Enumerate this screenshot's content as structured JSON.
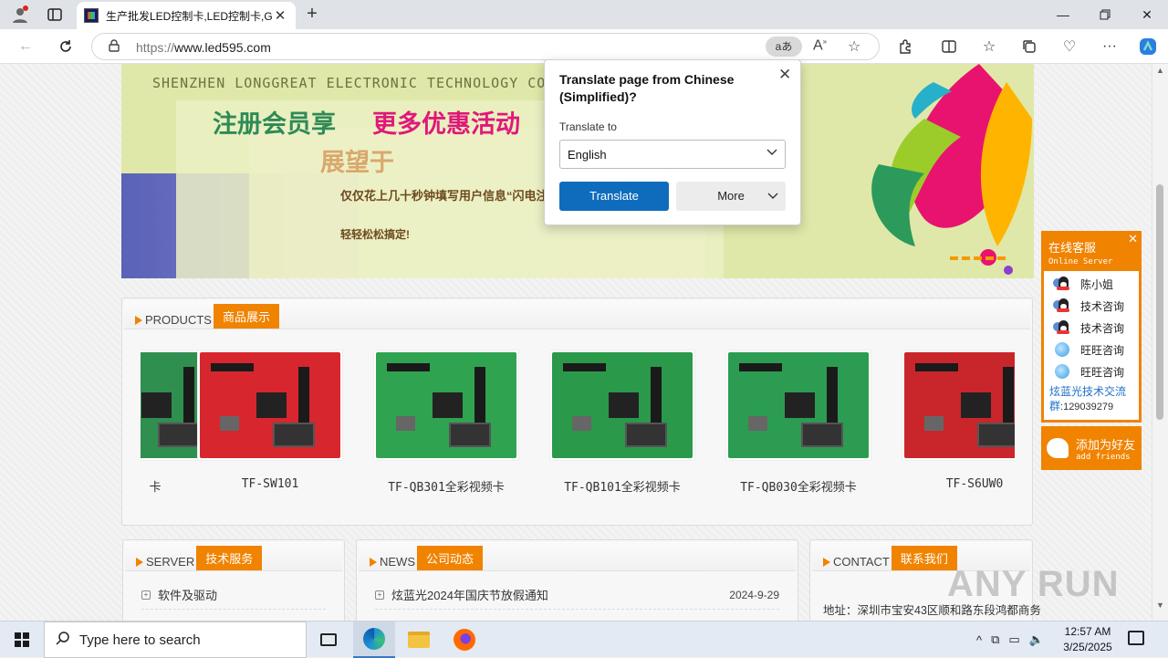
{
  "browser": {
    "tab_title": "生产批发LED控制卡,LED控制卡,G",
    "url_prefix": "https://",
    "url_host": "www.led595.com",
    "translate_icon": "aあ"
  },
  "banner": {
    "english_line": "SHENZHEN LONGGREAT ELECTRONIC TECHNOLOGY CO.,LTD",
    "line1_a": "注册会员享",
    "line1_b": "更多优惠活动",
    "line2": "展望于",
    "line3": "仅仅花上几十秒钟填写用户信息“闪电注册”，",
    "line4": "轻轻松松搞定!"
  },
  "products": {
    "title_en": "PRODUCTS",
    "title_cn": "商品展示",
    "items": [
      {
        "name": "卡",
        "color": "#2f8f4e"
      },
      {
        "name": "TF-SW101",
        "color": "#d8262e"
      },
      {
        "name": "TF-QB301全彩视频卡",
        "color": "#2fa34f"
      },
      {
        "name": "TF-QB101全彩视频卡",
        "color": "#2a9a4a"
      },
      {
        "name": "TF-QB030全彩视频卡",
        "color": "#2b9c52"
      },
      {
        "name": "TF-S6UW0",
        "color": "#c9262c"
      }
    ]
  },
  "server": {
    "title_en": "SERVER",
    "title_cn": "技术服务",
    "items": [
      {
        "text": "软件及驱动"
      }
    ]
  },
  "news": {
    "title_en": "NEWS",
    "title_cn": "公司动态",
    "items": [
      {
        "text": "炫蓝光2024年国庆节放假通知",
        "date": "2024-9-29"
      }
    ]
  },
  "contact": {
    "title_en": "CONTACT",
    "title_cn": "联系我们",
    "address": "地址：深圳市宝安43区顺和路东段鸿都商务"
  },
  "translate_popup": {
    "title": "Translate page from Chinese (Simplified)?",
    "label": "Translate to",
    "selected_language": "English",
    "translate_button": "Translate",
    "more_button": "More"
  },
  "chat": {
    "title_cn": "在线客服",
    "title_en": "Online Server",
    "contacts": [
      {
        "name": "陈小姐",
        "type": "qq"
      },
      {
        "name": "技术咨询",
        "type": "qq"
      },
      {
        "name": "技术咨询",
        "type": "qq"
      },
      {
        "name": "旺旺咨询",
        "type": "wangwang"
      },
      {
        "name": "旺旺咨询",
        "type": "wangwang"
      }
    ],
    "group_label": "炫蓝光技术交流群",
    "group_number": ":129039279",
    "add_cn": "添加为好友",
    "add_en": "add friends"
  },
  "watermark": "ANY RUN",
  "taskbar": {
    "search_placeholder": "Type here to search",
    "time": "12:57 AM",
    "date": "3/25/2025"
  }
}
